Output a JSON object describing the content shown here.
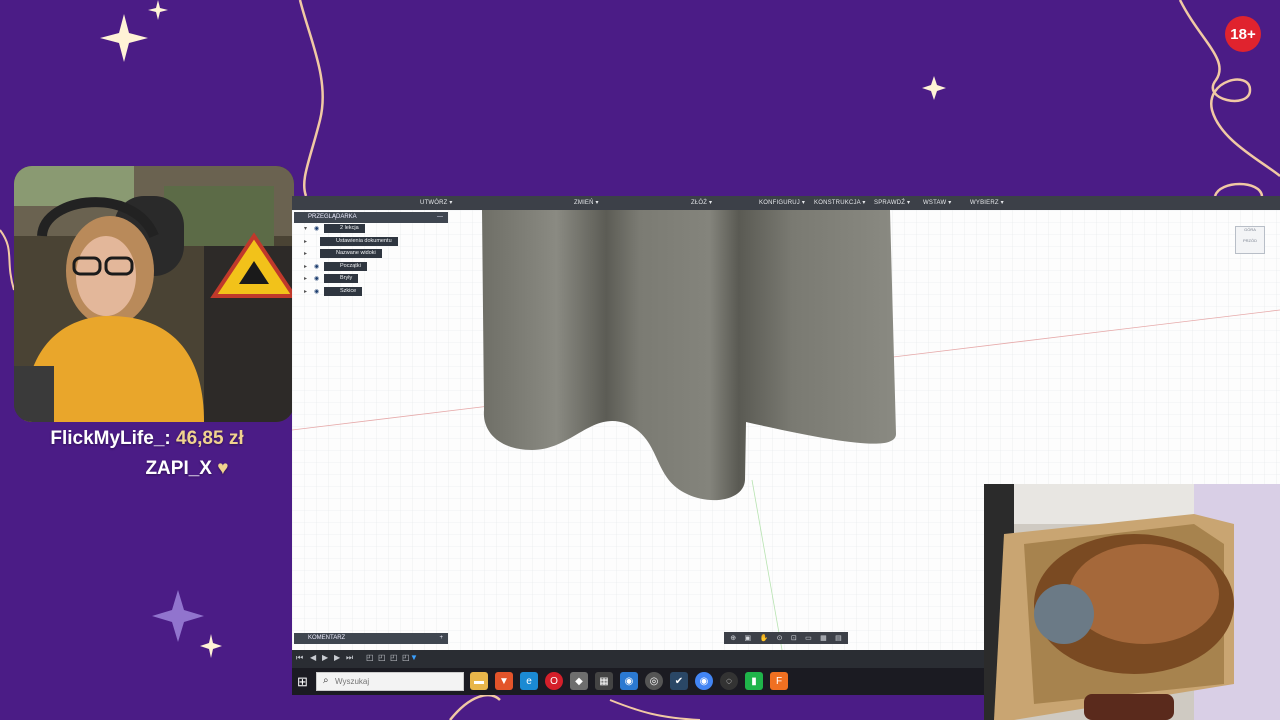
{
  "overlay": {
    "age_badge": "18+",
    "donation": {
      "name": "FlickMyLife_:",
      "amount": "46,85 zł",
      "supporter": "ZAPI_X",
      "heart": "♥"
    }
  },
  "fusion": {
    "toolbar": [
      "UTWÓRZ ▾",
      "ZMIEŃ ▾",
      "ZŁÓŻ ▾",
      "KONFIGURUJ ▾",
      "KONSTRUKCJA ▾",
      "SPRAWDŹ ▾",
      "WSTAW ▾",
      "WYBIERZ ▾"
    ],
    "browser": {
      "title": "PRZEGLĄDARKA",
      "items": [
        "2 lekcja",
        "Ustawienia dokumentu",
        "Nazwane widoki",
        "Początki",
        "Bryły",
        "Szkice"
      ]
    },
    "comments_label": "KOMENTARZ",
    "viewcube": {
      "top": "GÓRA",
      "front": "PRZÓD"
    }
  },
  "taskbar": {
    "search_placeholder": "Wyszukaj"
  },
  "colors": {
    "overlay_purple": "#4b1c86",
    "overlay_gold": "#f1d38f",
    "model_gray": "#77776f",
    "badge_red": "#e0232e"
  },
  "icons": [
    "windows-start-icon",
    "search-icon",
    "file-explorer-icon",
    "brave-icon",
    "edge-icon",
    "opera-icon",
    "chrome-icon",
    "steam-icon",
    "fusion-icon"
  ]
}
